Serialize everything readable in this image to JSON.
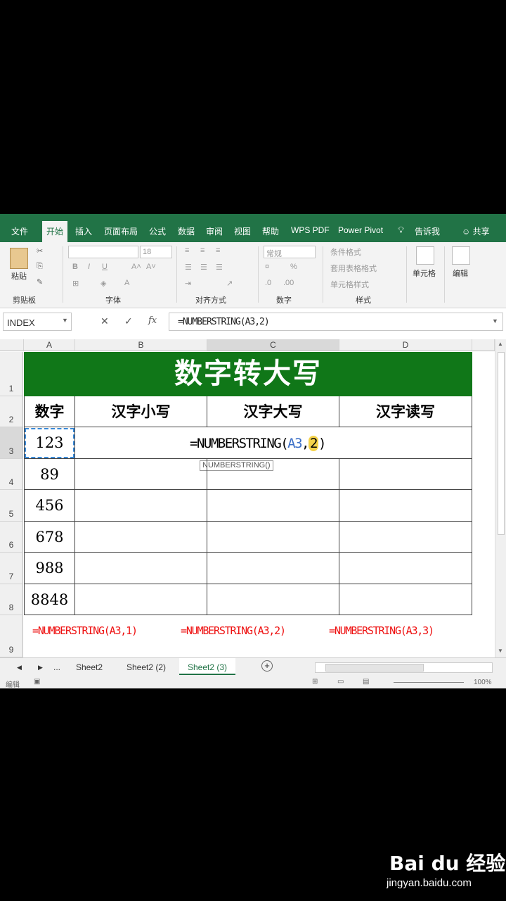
{
  "ribbon": {
    "tabs": [
      "文件",
      "开始",
      "插入",
      "页面布局",
      "公式",
      "数据",
      "审阅",
      "视图",
      "帮助",
      "WPS PDF",
      "Power Pivot",
      "告诉我",
      "共享"
    ],
    "groups": {
      "clipboard": "剪贴板",
      "paste": "粘贴",
      "font": "字体",
      "font_size": "18",
      "align": "对齐方式",
      "number": "数字",
      "number_format": "常规",
      "styles": "样式",
      "conditional": "条件格式",
      "table_format": "套用表格格式",
      "cell_style": "单元格样式",
      "cells": "单元格",
      "edit": "编辑"
    }
  },
  "formula_bar": {
    "name_box": "INDEX",
    "cancel": "✕",
    "enter": "✓",
    "fx": "fx",
    "formula": "=NUMBERSTRING(A3,2)"
  },
  "grid": {
    "columns": [
      "A",
      "B",
      "C",
      "D"
    ],
    "rows": [
      "1",
      "2",
      "3",
      "4",
      "5",
      "6",
      "7",
      "8",
      "9"
    ],
    "title": "数字转大写",
    "headers": [
      "数字",
      "汉字小写",
      "汉字大写",
      "汉字读写"
    ],
    "numbers": [
      "123",
      "89",
      "456",
      "678",
      "988",
      "8848"
    ],
    "editing": {
      "prefix": "=NUMBERSTRING(",
      "ref": "A3",
      "comma": ",",
      "arg": "2",
      "close": ")",
      "tooltip": "NUMBERSTRING()"
    },
    "notes": [
      "=NUMBERSTRING(A3,1)",
      "=NUMBERSTRING(A3,2)",
      "=NUMBERSTRING(A3,3)"
    ]
  },
  "sheets": {
    "more": "...",
    "tabs": [
      "Sheet2",
      "Sheet2 (2)",
      "Sheet2 (3)"
    ],
    "active": "Sheet2 (3)",
    "add": "+"
  },
  "status": {
    "mode": "编辑",
    "zoom": "100%"
  },
  "watermark": {
    "brand": "Bai du 经验",
    "url": "jingyan.baidu.com"
  }
}
